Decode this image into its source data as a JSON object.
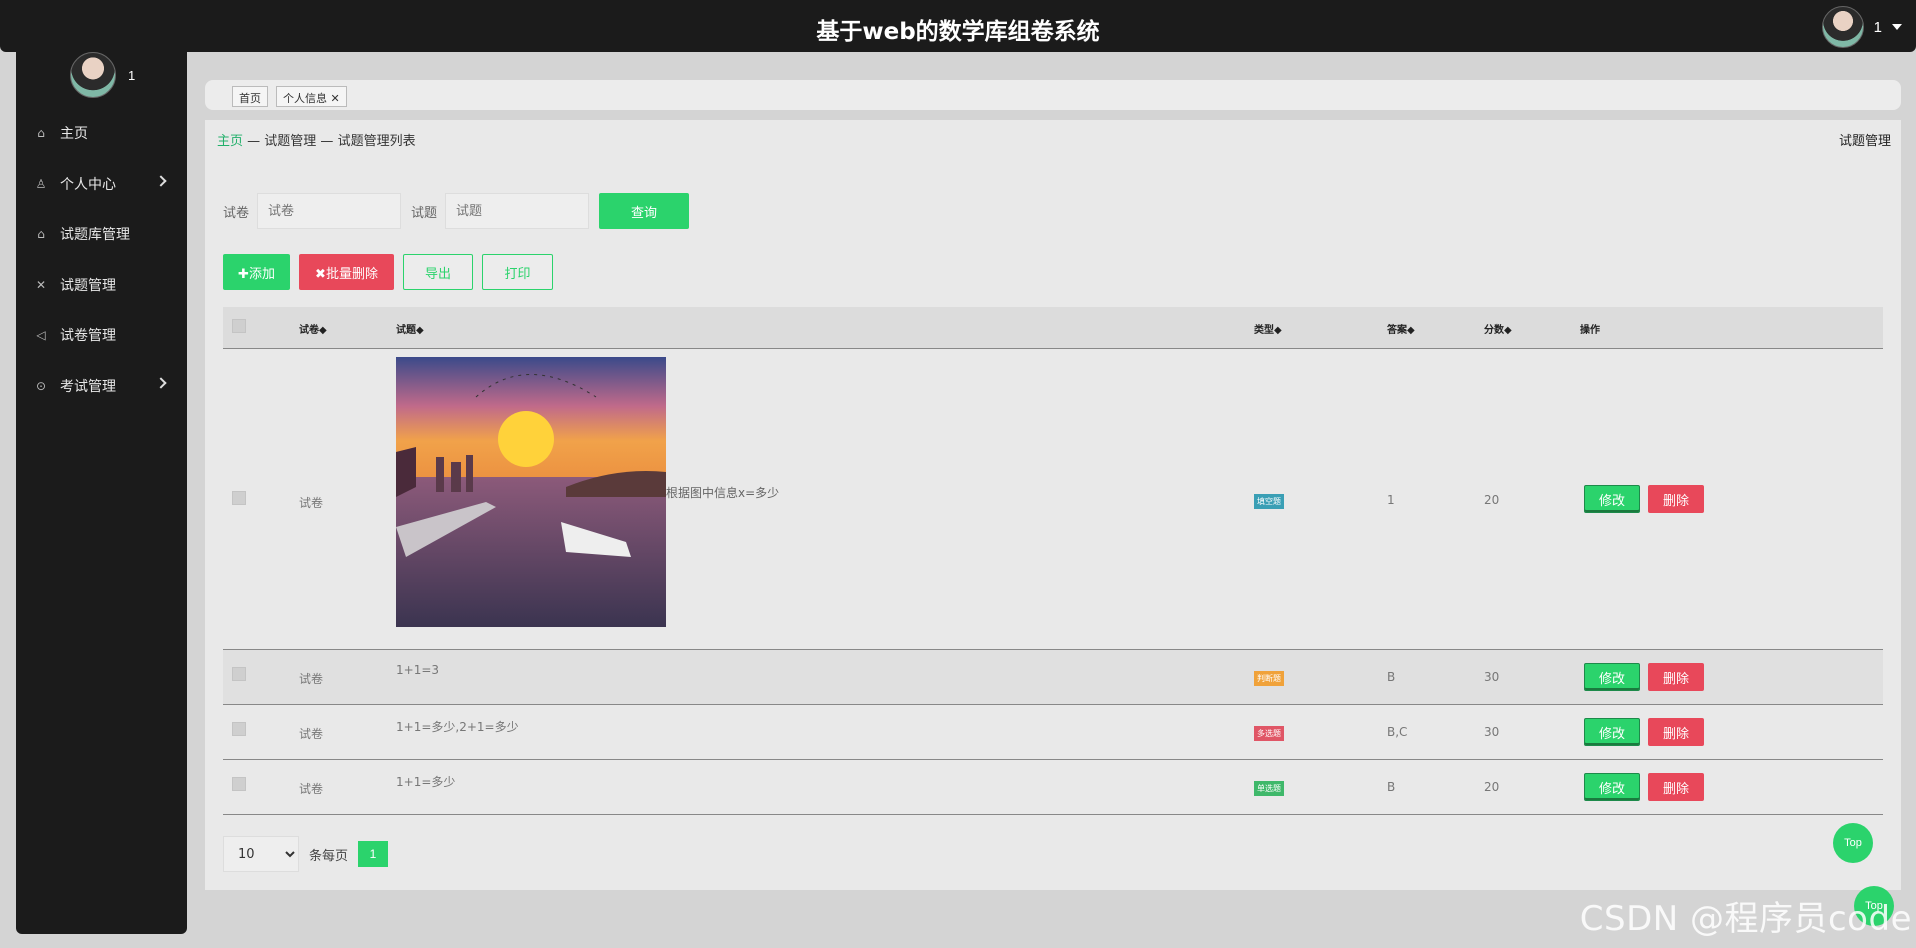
{
  "app": {
    "title": "基于web的数学库组卷系统",
    "user_name": "1"
  },
  "sidebar": {
    "user_name": "1",
    "items": [
      {
        "label": "主页",
        "icon": "home-icon",
        "glyph": "⌂",
        "has_arrow": false
      },
      {
        "label": "个人中心",
        "icon": "user-icon",
        "glyph": "♙",
        "has_arrow": true
      },
      {
        "label": "试题库管理",
        "icon": "house-icon",
        "glyph": "⌂",
        "has_arrow": false
      },
      {
        "label": "试题管理",
        "icon": "close-icon",
        "glyph": "✕",
        "has_arrow": false
      },
      {
        "label": "试卷管理",
        "icon": "speaker-icon",
        "glyph": "◁",
        "has_arrow": false
      },
      {
        "label": "考试管理",
        "icon": "download-circle-icon",
        "glyph": "⊙",
        "has_arrow": true
      }
    ]
  },
  "tabs": [
    {
      "label": "首页"
    },
    {
      "label": "个人信息 ✕"
    }
  ],
  "breadcrumb": {
    "home": "主页",
    "sep1": " — ",
    "level2": "试题管理",
    "sep2": " — ",
    "level3": "试题管理列表"
  },
  "panel_title": "试题管理",
  "search": {
    "paper_label": "试卷",
    "paper_placeholder": "试卷",
    "question_label": "试题",
    "question_placeholder": "试题",
    "query_button": "查询"
  },
  "toolbar": {
    "add": "✚添加",
    "batch_delete": "✖批量删除",
    "export": "导出",
    "print": "打印"
  },
  "table": {
    "headers": {
      "paper": "试卷◆",
      "question": "试题◆",
      "type": "类型◆",
      "answer": "答案◆",
      "score": "分数◆",
      "actions": "操作"
    },
    "rows": [
      {
        "paper": "试卷",
        "question": "根据图中信息x=多少",
        "type": "填空题",
        "type_color": "#3a9fb5",
        "answer": "1",
        "score": "20",
        "edit": "修改",
        "delete": "删除"
      },
      {
        "paper": "试卷",
        "question": "1+1=3",
        "type": "判断题",
        "type_color": "#f0a23a",
        "answer": "B",
        "score": "30",
        "edit": "修改",
        "delete": "删除"
      },
      {
        "paper": "试卷",
        "question": "1+1=多少,2+1=多少",
        "type": "多选题",
        "type_color": "#e05666",
        "answer": "B,C",
        "score": "30",
        "edit": "修改",
        "delete": "删除"
      },
      {
        "paper": "试卷",
        "question": "1+1=多少",
        "type": "单选题",
        "type_color": "#3fb86a",
        "answer": "B",
        "score": "20",
        "edit": "修改",
        "delete": "删除"
      }
    ]
  },
  "pager": {
    "page_size": "10",
    "per_page_label": "条每页",
    "current_page": "1"
  },
  "top_button": "Top",
  "watermark": "CSDN @程序员code",
  "colors": {
    "accent": "#2bd36c",
    "danger": "#e8485a",
    "sidebar": "#1b1b1b"
  }
}
